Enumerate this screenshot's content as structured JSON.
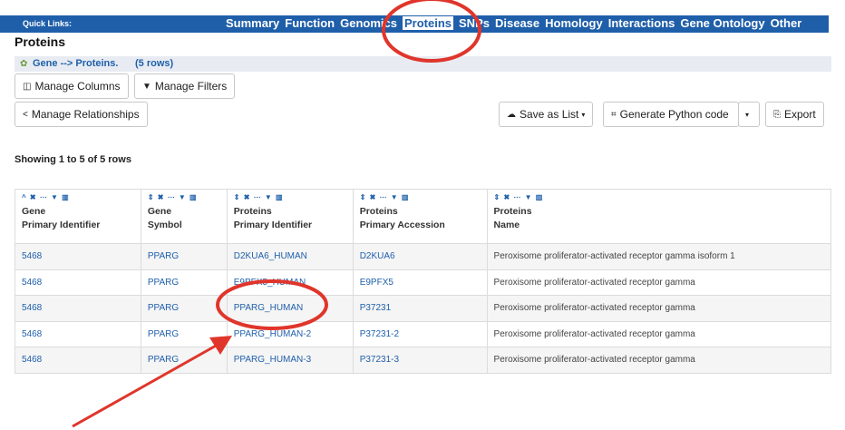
{
  "quick_links": {
    "label": "Quick Links:",
    "items": [
      "Summary",
      "Function",
      "Genomics",
      "Proteins",
      "SNPs",
      "Disease",
      "Homology",
      "Interactions",
      "Gene Ontology",
      "Other"
    ],
    "active": "Proteins"
  },
  "page_title": "Proteins",
  "breadcrumb": {
    "path": "Gene --> Proteins.",
    "rows": "(5 rows)"
  },
  "toolbar": {
    "manage_columns": "Manage Columns",
    "manage_filters": "Manage Filters",
    "manage_relationships": "Manage Relationships",
    "save_as_list": "Save as List",
    "generate_code": "Generate Python code",
    "export": "Export"
  },
  "showing_text": "Showing 1 to 5 of 5 rows",
  "table": {
    "columns": [
      {
        "line1": "Gene",
        "line2": "Primary Identifier"
      },
      {
        "line1": "Gene",
        "line2": "Symbol"
      },
      {
        "line1": "Proteins",
        "line2": "Primary Identifier"
      },
      {
        "line1": "Proteins",
        "line2": "Primary Accession"
      },
      {
        "line1": "Proteins",
        "line2": "Name"
      }
    ],
    "rows": [
      [
        "5468",
        "PPARG",
        "D2KUA6_HUMAN",
        "D2KUA6",
        "Peroxisome proliferator-activated receptor gamma isoform 1"
      ],
      [
        "5468",
        "PPARG",
        "E9PFX5_HUMAN",
        "E9PFX5",
        "Peroxisome proliferator-activated receptor gamma"
      ],
      [
        "5468",
        "PPARG",
        "PPARG_HUMAN",
        "P37231",
        "Peroxisome proliferator-activated receptor gamma"
      ],
      [
        "5468",
        "PPARG",
        "PPARG_HUMAN-2",
        "P37231-2",
        "Peroxisome proliferator-activated receptor gamma"
      ],
      [
        "5468",
        "PPARG",
        "PPARG_HUMAN-3",
        "P37231-3",
        "Peroxisome proliferator-activated receptor gamma"
      ]
    ]
  },
  "colors": {
    "nav": "#1f5faa",
    "annotation": "#e0352b"
  }
}
